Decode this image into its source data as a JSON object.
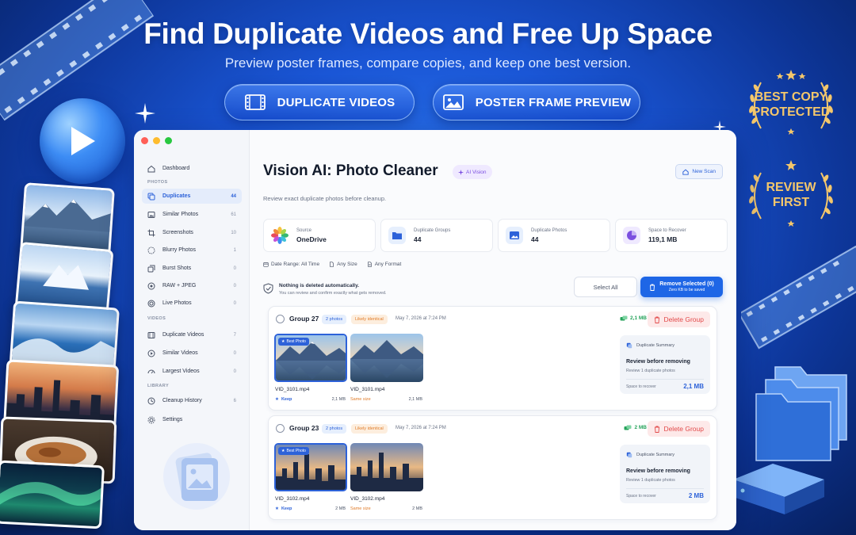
{
  "hero": {
    "headline": "Find Duplicate Videos and Free Up Space",
    "subline": "Preview poster frames, compare copies, and keep one best version.",
    "pill_1": "DUPLICATE VIDEOS",
    "pill_2": "POSTER FRAME PREVIEW",
    "badge_1": "BEST COPY\nPROTECTED",
    "badge_2": "REVIEW\nFIRST"
  },
  "sidebar": {
    "dashboard": "Dashboard",
    "section_photos": "PHOTOS",
    "section_videos": "VIDEOS",
    "section_library": "LIBRARY",
    "items": [
      {
        "label": "Duplicates",
        "count": "44"
      },
      {
        "label": "Similar Photos",
        "count": "61"
      },
      {
        "label": "Screenshots",
        "count": "10"
      },
      {
        "label": "Blurry Photos",
        "count": "1"
      },
      {
        "label": "Burst Shots",
        "count": "0"
      },
      {
        "label": "RAW + JPEG",
        "count": "0"
      },
      {
        "label": "Live Photos",
        "count": "0"
      },
      {
        "label": "Duplicate Videos",
        "count": "7"
      },
      {
        "label": "Similar Videos",
        "count": "0"
      },
      {
        "label": "Largest Videos",
        "count": "0"
      },
      {
        "label": "Cleanup History",
        "count": "6"
      },
      {
        "label": "Settings",
        "count": ""
      }
    ]
  },
  "header": {
    "title": "Vision AI: Photo Cleaner",
    "ai_chip": "AI Vision",
    "new_scan": "New Scan",
    "subtitle": "Review exact duplicate photos before cleanup."
  },
  "stats": [
    {
      "label": "Source",
      "value": "OneDrive"
    },
    {
      "label": "Duplicate Groups",
      "value": "44"
    },
    {
      "label": "Duplicate Photos",
      "value": "44"
    },
    {
      "label": "Space to Recover",
      "value": "119,1 MB"
    }
  ],
  "filters": {
    "date": "Date Range: All Time",
    "size": "Any Size",
    "format": "Any Format"
  },
  "notice": {
    "title": "Nothing is deleted automatically.",
    "text": "You can review and confirm exactly what gets removed."
  },
  "actions": {
    "select_all": "Select All",
    "remove": "Remove Selected (0)",
    "remove_sub": "Zero KB to be saved"
  },
  "groups": [
    {
      "name": "Group 27",
      "count": "2 photos",
      "ident": "Likely identical",
      "date": "May 7, 2026 at 7:24 PM",
      "size": "2,1 MB",
      "delete": "Delete Group",
      "best_tag": "Best Photo",
      "file_a": "VID_3101.mp4",
      "file_b": "VID_3101.mp4",
      "keep": "Keep",
      "same": "Same size",
      "fsize_a": "2,1 MB",
      "fsize_b": "2,1 MB",
      "sum_title": "Duplicate Summary",
      "sum_head": "Review before removing",
      "sum_sub": "Review 1 duplicate photos",
      "sum_rec": "Space to recover",
      "sum_val": "2,1 MB"
    },
    {
      "name": "Group 23",
      "count": "2 photos",
      "ident": "Likely identical",
      "date": "May 7, 2026 at 7:24 PM",
      "size": "2 MB",
      "delete": "Delete Group",
      "best_tag": "Best Photo",
      "file_a": "VID_3102.mp4",
      "file_b": "VID_3102.mp4",
      "keep": "Keep",
      "same": "Same size",
      "fsize_a": "2 MB",
      "fsize_b": "2 MB",
      "sum_title": "Duplicate Summary",
      "sum_head": "Review before removing",
      "sum_sub": "Review 1 duplicate photos",
      "sum_rec": "Space to recover",
      "sum_val": "2 MB"
    }
  ],
  "colors": {
    "accent": "#2d62d9",
    "primary_button": "#1e66e6",
    "danger": "#e24a4a",
    "success": "#26a35b",
    "warning": "#e07c2a",
    "gold": "#f4c76b"
  }
}
